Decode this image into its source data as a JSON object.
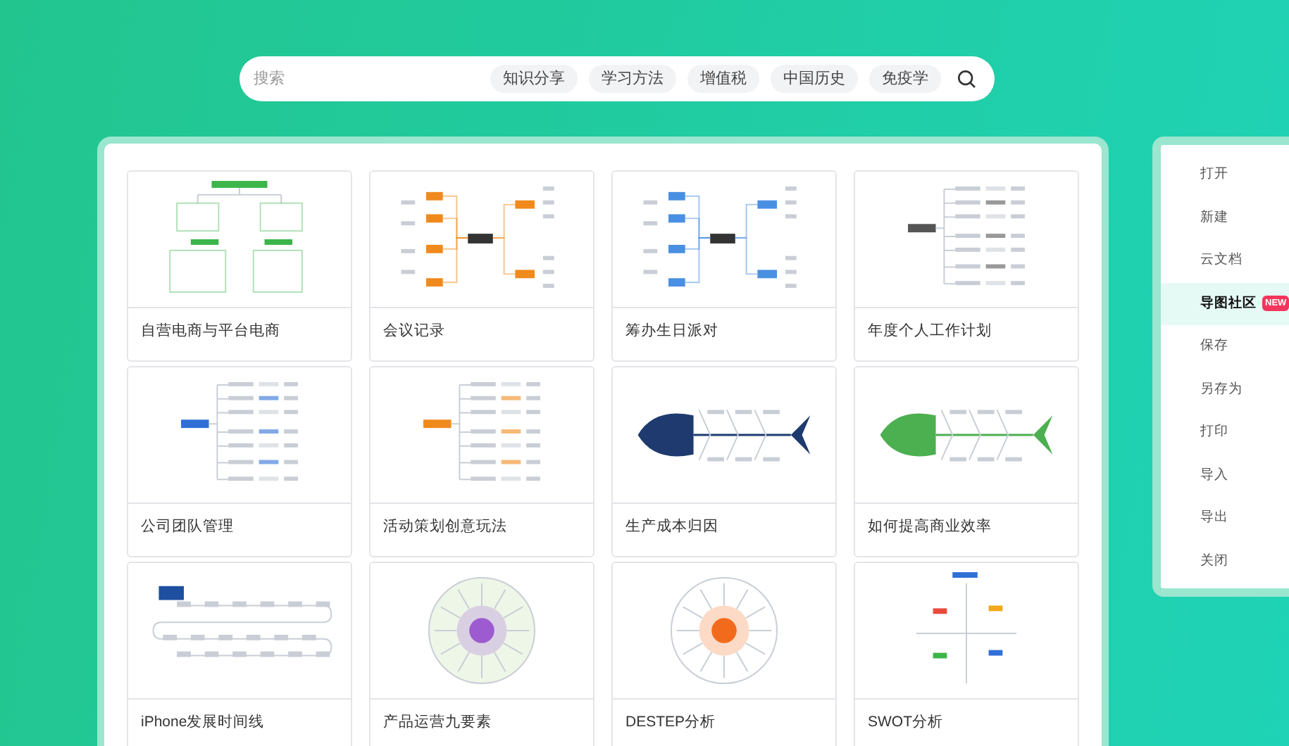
{
  "search": {
    "placeholder": "搜索",
    "tags": [
      "知识分享",
      "学习方法",
      "增值税",
      "中国历史",
      "免疫学"
    ]
  },
  "templates": [
    {
      "title": "自营电商与平台电商",
      "kind": "tree",
      "color": "#3cb54a"
    },
    {
      "title": "会议记录",
      "kind": "mindmap",
      "color": "#f08a1c"
    },
    {
      "title": "筹办生日派对",
      "kind": "mindmap",
      "color": "#4a90e2"
    },
    {
      "title": "年度个人工作计划",
      "kind": "outline",
      "color": "#555555"
    },
    {
      "title": "公司团队管理",
      "kind": "outline",
      "color": "#2f6fd6"
    },
    {
      "title": "活动策划创意玩法",
      "kind": "outline",
      "color": "#f08a1c"
    },
    {
      "title": "生产成本归因",
      "kind": "fishbone",
      "color": "#1e3a6e"
    },
    {
      "title": "如何提高商业效率",
      "kind": "fishbone",
      "color": "#4caf50"
    },
    {
      "title": "iPhone发展时间线",
      "kind": "timeline",
      "color": "#1e4fa0"
    },
    {
      "title": "产品运营九要素",
      "kind": "radial",
      "color": "#9c5bd1"
    },
    {
      "title": "DESTEP分析",
      "kind": "radial",
      "color": "#f26b1d"
    },
    {
      "title": "SWOT分析",
      "kind": "quadrant",
      "color": "#2f6fd6"
    }
  ],
  "menu": [
    {
      "label": "打开",
      "selected": false
    },
    {
      "label": "新建",
      "selected": false
    },
    {
      "label": "云文档",
      "selected": false
    },
    {
      "label": "导图社区",
      "selected": true,
      "badge": "NEW"
    },
    {
      "label": "保存",
      "selected": false
    },
    {
      "label": "另存为",
      "selected": false
    },
    {
      "label": "打印",
      "selected": false
    },
    {
      "label": "导入",
      "selected": false
    },
    {
      "label": "导出",
      "selected": false
    },
    {
      "label": "关闭",
      "selected": false
    }
  ]
}
